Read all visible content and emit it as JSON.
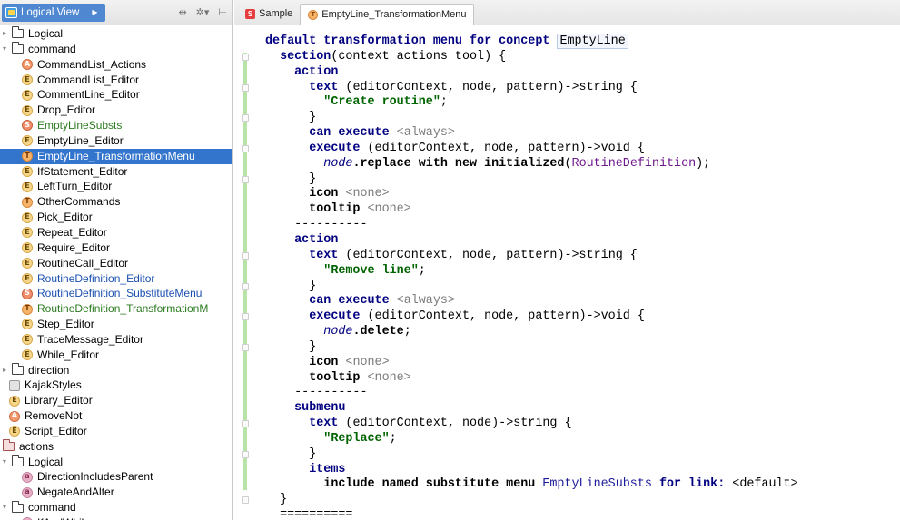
{
  "sidebar": {
    "view_label": "Logical View",
    "tree": [
      {
        "indent": 0,
        "twisty": "▸",
        "icon": "folder",
        "label": "Logical"
      },
      {
        "indent": 0,
        "twisty": "▾",
        "icon": "folder",
        "label": "command"
      },
      {
        "indent": 1,
        "icon": "a",
        "label": "CommandList_Actions"
      },
      {
        "indent": 1,
        "icon": "e",
        "label": "CommandList_Editor"
      },
      {
        "indent": 1,
        "icon": "e",
        "label": "CommentLine_Editor"
      },
      {
        "indent": 1,
        "icon": "e",
        "label": "Drop_Editor"
      },
      {
        "indent": 1,
        "icon": "s",
        "label": "EmptyLineSubsts",
        "color": "green"
      },
      {
        "indent": 1,
        "icon": "e",
        "label": "EmptyLine_Editor"
      },
      {
        "indent": 1,
        "icon": "t",
        "label": "EmptyLine_TransformationMenu",
        "selected": true
      },
      {
        "indent": 1,
        "icon": "e",
        "label": "IfStatement_Editor"
      },
      {
        "indent": 1,
        "icon": "e",
        "label": "LeftTurn_Editor"
      },
      {
        "indent": 1,
        "icon": "t",
        "label": "OtherCommands"
      },
      {
        "indent": 1,
        "icon": "e",
        "label": "Pick_Editor"
      },
      {
        "indent": 1,
        "icon": "e",
        "label": "Repeat_Editor"
      },
      {
        "indent": 1,
        "icon": "e",
        "label": "Require_Editor"
      },
      {
        "indent": 1,
        "icon": "e",
        "label": "RoutineCall_Editor"
      },
      {
        "indent": 1,
        "icon": "e",
        "label": "RoutineDefinition_Editor",
        "color": "blue"
      },
      {
        "indent": 1,
        "icon": "s",
        "label": "RoutineDefinition_SubstituteMenu",
        "color": "blue"
      },
      {
        "indent": 1,
        "icon": "t",
        "label": "RoutineDefinition_TransformationM",
        "color": "green"
      },
      {
        "indent": 1,
        "icon": "e",
        "label": "Step_Editor"
      },
      {
        "indent": 1,
        "icon": "e",
        "label": "TraceMessage_Editor"
      },
      {
        "indent": 1,
        "icon": "e",
        "label": "While_Editor"
      },
      {
        "indent": 0,
        "twisty": "▸",
        "icon": "folder",
        "label": "direction"
      },
      {
        "indent": 0,
        "icon": "styles",
        "label": "KajakStyles"
      },
      {
        "indent": 0,
        "icon": "e",
        "label": "Library_Editor"
      },
      {
        "indent": 0,
        "icon": "a",
        "label": "RemoveNot"
      },
      {
        "indent": 0,
        "icon": "e",
        "label": "Script_Editor"
      },
      {
        "indent": -1,
        "icon": "folder-red",
        "label": "actions"
      },
      {
        "indent": 0,
        "twisty": "▾",
        "icon": "folder",
        "label": "Logical"
      },
      {
        "indent": 1,
        "icon": "ac",
        "label": "DirectionIncludesParent"
      },
      {
        "indent": 1,
        "icon": "ac",
        "label": "NegateAndAlter"
      },
      {
        "indent": 0,
        "twisty": "▾",
        "icon": "folder",
        "label": "command"
      },
      {
        "indent": 1,
        "icon": "ac",
        "label": "IfAndWhile"
      }
    ]
  },
  "tabs": [
    {
      "label": "Sample",
      "icon": "s",
      "active": false
    },
    {
      "label": "EmptyLine_TransformationMenu",
      "icon": "t",
      "active": true
    }
  ],
  "code": [
    [
      [
        "kw",
        "default transformation menu for concept "
      ],
      [
        "boxed",
        "EmptyLine"
      ]
    ],
    [
      [
        "kw",
        "  section"
      ],
      [
        "plain",
        "(context actions tool) {"
      ]
    ],
    [
      [
        "kw",
        "    action"
      ]
    ],
    [
      [
        "kw",
        "      text "
      ],
      [
        "plain",
        "(editorContext, node, pattern)->string {"
      ]
    ],
    [
      [
        "str",
        "        \"Create routine\""
      ],
      [
        "plain",
        ";"
      ]
    ],
    [
      [
        "plain",
        "      }"
      ]
    ],
    [
      [
        "kw",
        "      can execute "
      ],
      [
        "muted",
        "<always>"
      ]
    ],
    [
      [
        "kw",
        "      execute "
      ],
      [
        "plain",
        "(editorContext, node, pattern)->void {"
      ]
    ],
    [
      [
        "it",
        "        node"
      ],
      [
        "txt",
        ".replace with new initialized"
      ],
      [
        "plain",
        "("
      ],
      [
        "cls",
        "RoutineDefinition"
      ],
      [
        "plain",
        ");"
      ]
    ],
    [
      [
        "plain",
        "      }"
      ]
    ],
    [
      [
        "txt",
        "      icon "
      ],
      [
        "muted",
        "<none>"
      ]
    ],
    [
      [
        "txt",
        "      tooltip "
      ],
      [
        "muted",
        "<none>"
      ]
    ],
    [
      [
        "sep",
        "    ----------"
      ]
    ],
    [
      [
        "kw",
        "    action"
      ]
    ],
    [
      [
        "kw",
        "      text "
      ],
      [
        "plain",
        "(editorContext, node, pattern)->string {"
      ]
    ],
    [
      [
        "str",
        "        \"Remove line\""
      ],
      [
        "plain",
        ";"
      ]
    ],
    [
      [
        "plain",
        "      }"
      ]
    ],
    [
      [
        "kw",
        "      can execute "
      ],
      [
        "muted",
        "<always>"
      ]
    ],
    [
      [
        "kw",
        "      execute "
      ],
      [
        "plain",
        "(editorContext, node, pattern)->void {"
      ]
    ],
    [
      [
        "it",
        "        node"
      ],
      [
        "txt",
        ".delete"
      ],
      [
        "plain",
        ";"
      ]
    ],
    [
      [
        "plain",
        "      }"
      ]
    ],
    [
      [
        "txt",
        "      icon "
      ],
      [
        "muted",
        "<none>"
      ]
    ],
    [
      [
        "txt",
        "      tooltip "
      ],
      [
        "muted",
        "<none>"
      ]
    ],
    [
      [
        "sep",
        "    ----------"
      ]
    ],
    [
      [
        "kw",
        "    submenu"
      ]
    ],
    [
      [
        "kw",
        "      text "
      ],
      [
        "plain",
        "(editorContext, node)->string {"
      ]
    ],
    [
      [
        "str",
        "        \"Replace\""
      ],
      [
        "plain",
        ";"
      ]
    ],
    [
      [
        "plain",
        "      }"
      ]
    ],
    [
      [
        "kw",
        "      items"
      ]
    ],
    [
      [
        "txt",
        "        include named substitute menu "
      ],
      [
        "cpt",
        "EmptyLineSubsts "
      ],
      [
        "kw",
        "for link: "
      ],
      [
        "plain",
        "<default>"
      ]
    ],
    [
      [
        "plain",
        "  }"
      ]
    ],
    [
      [
        "sep",
        "  =========="
      ]
    ]
  ]
}
